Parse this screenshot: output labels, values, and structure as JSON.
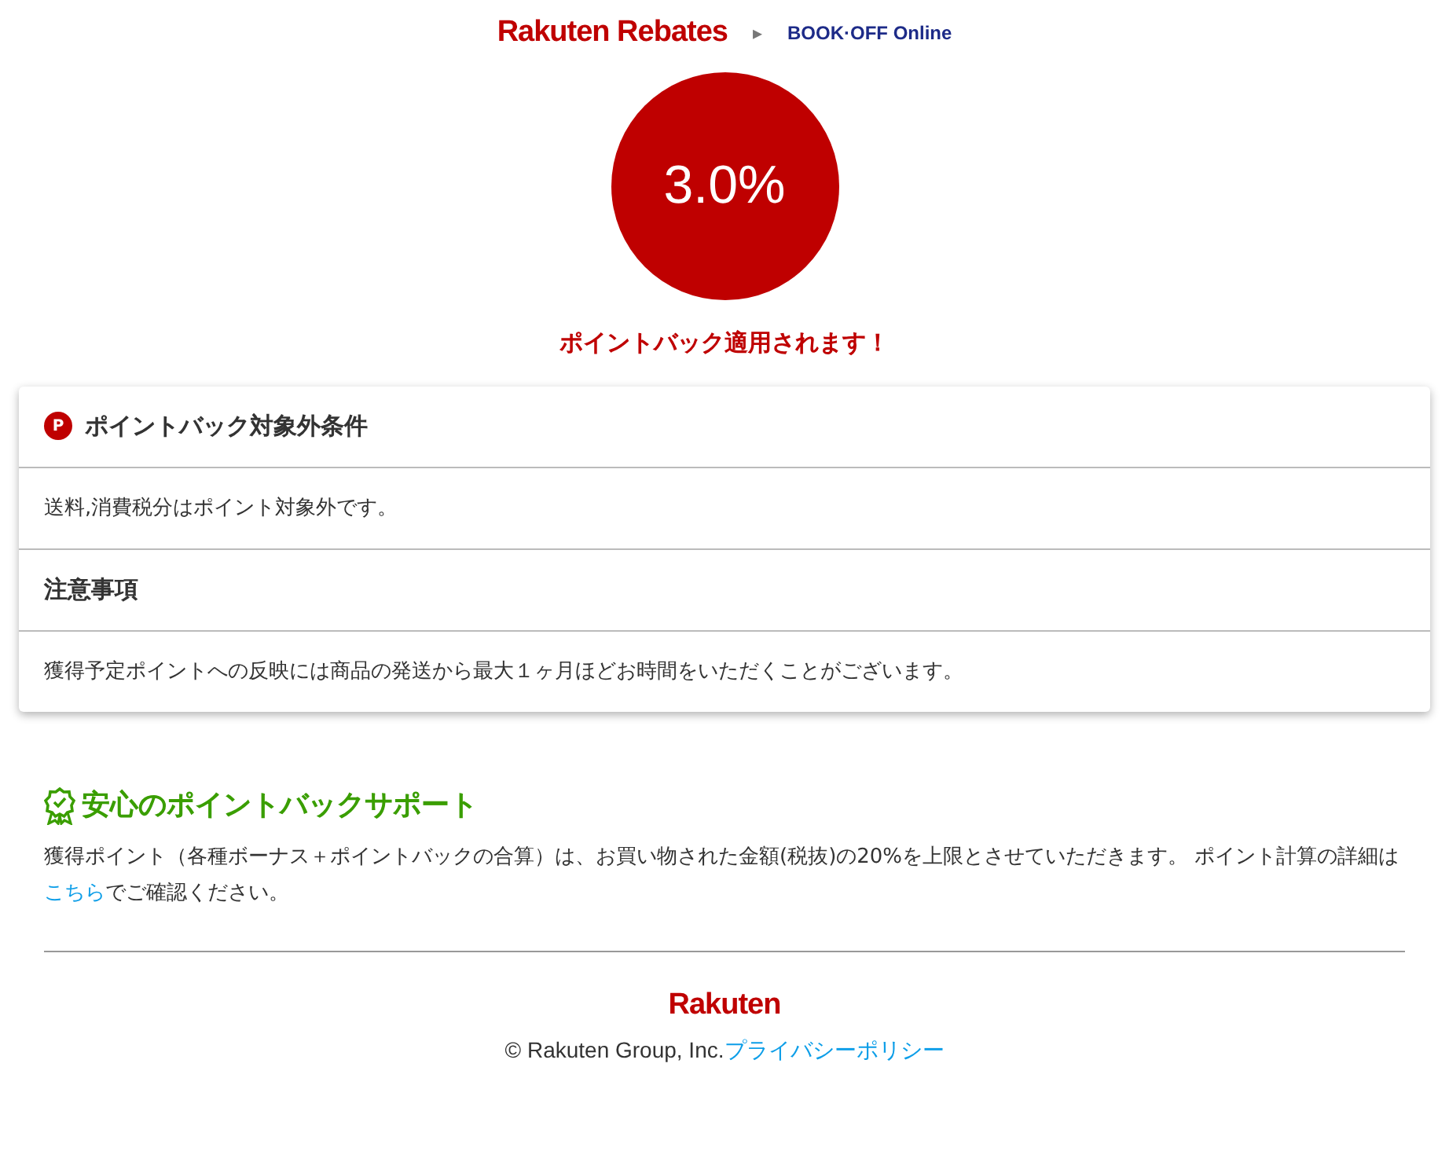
{
  "header": {
    "brand": "Rakuten Rebates",
    "separator": "▸",
    "store": "BOOK·OFF Online"
  },
  "rate": {
    "value": "3.0%",
    "message": "ポイントバック適用されます！"
  },
  "conditions": [
    {
      "kind": "heading",
      "text": "ポイントバック対象外条件",
      "badge": "P"
    },
    {
      "kind": "body",
      "text": "送料,消費税分はポイント対象外です。"
    },
    {
      "kind": "heading",
      "text": "注意事項"
    },
    {
      "kind": "body",
      "text": "獲得予定ポイントへの反映には商品の発送から最大１ヶ月ほどお時間をいただくことがございます。"
    }
  ],
  "support": {
    "title": "安心のポイントバックサポート",
    "text_before": "獲得ポイント（各種ボーナス＋ポイントバックの合算）は、お買い物された金額(税抜)の20%を上限とさせていただきます。 ポイント計算の詳細は",
    "link": "こちら",
    "text_after": "でご確認ください。"
  },
  "footer": {
    "logo": "Rakuten",
    "copyright": "© Rakuten Group, Inc.",
    "link": "プライバシーポリシー"
  }
}
